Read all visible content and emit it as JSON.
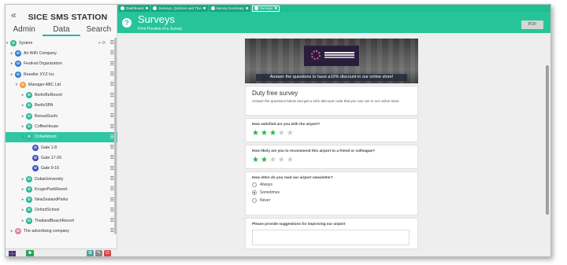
{
  "sidebar": {
    "collapse_label": "«",
    "app_title": "SICE SMS STATION",
    "tabs": [
      "Admin",
      "Data",
      "Search"
    ],
    "active_tab": "Data",
    "tree": [
      {
        "label": "System",
        "level": 0,
        "icon": "teal",
        "caret": "▾",
        "extra": "+ ⟳"
      },
      {
        "label": "Air WiFi Company",
        "level": 1,
        "icon": "blue",
        "caret": "▸"
      },
      {
        "label": "Festival Organization",
        "level": 1,
        "icon": "blue",
        "caret": "▸"
      },
      {
        "label": "Reseller XYZ Inc",
        "level": 1,
        "icon": "blue",
        "caret": "▸"
      },
      {
        "label": "Manager ABC Ltd",
        "level": 2,
        "icon": "orange",
        "caret": "▾"
      },
      {
        "label": "BerlinBeResort",
        "level": 3,
        "icon": "teal",
        "caret": "▸"
      },
      {
        "label": "BerlinSPA",
        "level": 3,
        "icon": "teal",
        "caret": "▸"
      },
      {
        "label": "BonsaiSushi",
        "level": 3,
        "icon": "teal",
        "caret": "▸"
      },
      {
        "label": "CoffeeHouse",
        "level": 3,
        "icon": "teal",
        "caret": "▸"
      },
      {
        "label": "DohaAirport",
        "level": 3,
        "icon": "teal",
        "caret": "▾",
        "selected": true
      },
      {
        "label": "Gate 1-8",
        "level": 4,
        "icon": "navy"
      },
      {
        "label": "Gate 17-26",
        "level": 4,
        "icon": "navy"
      },
      {
        "label": "Gate 9-16",
        "level": 4,
        "icon": "navy"
      },
      {
        "label": "DubaiUniversity",
        "level": 3,
        "icon": "teal",
        "caret": "▸"
      },
      {
        "label": "KrugerParkResort",
        "level": 3,
        "icon": "teal",
        "caret": "▸"
      },
      {
        "label": "NewZealandParks",
        "level": 3,
        "icon": "teal",
        "caret": "▸"
      },
      {
        "label": "OxfordSchool",
        "level": 3,
        "icon": "teal",
        "caret": "▸"
      },
      {
        "label": "ThailandBeachResort",
        "level": 3,
        "icon": "teal",
        "caret": "▸"
      },
      {
        "label": "The advertising company",
        "level": 1,
        "icon": "pink",
        "caret": "▸"
      }
    ],
    "menu_icon": "☰"
  },
  "tabs": [
    {
      "label": "Dashboard",
      "active": false
    },
    {
      "label": "Surveys, Quizzes and Trivi",
      "active": false
    },
    {
      "label": "Survey Summary",
      "active": false
    },
    {
      "label": "Surveys",
      "active": true
    }
  ],
  "header": {
    "help_icon": "?",
    "title": "Surveys",
    "subtitle": "Print Preview of a Survey",
    "pdf_button": "PDF"
  },
  "survey": {
    "banner_caption": "Answer the questions to have a10% discount in our online store!",
    "title": "Duty free survey",
    "description": "Answer the questions below and get a 10% discount code that you can use in our online store.",
    "questions": [
      {
        "text": "How satisfied are you with the airport?",
        "rating": 3,
        "max": 5
      },
      {
        "text": "How likely are you to recommend this airport to a friend or colleague?",
        "rating": 2,
        "max": 5
      }
    ],
    "radio_question": {
      "text": "How often do you read our airport newsletter?",
      "options": [
        "Always",
        "Sometimes",
        "Never"
      ],
      "selected": "Sometimes"
    },
    "text_question": "Please provide suggestions for improving our airport"
  },
  "colors": {
    "accent": "#27c49a",
    "star_on": "#27b34a",
    "selected_row": "#2fc6a3"
  }
}
